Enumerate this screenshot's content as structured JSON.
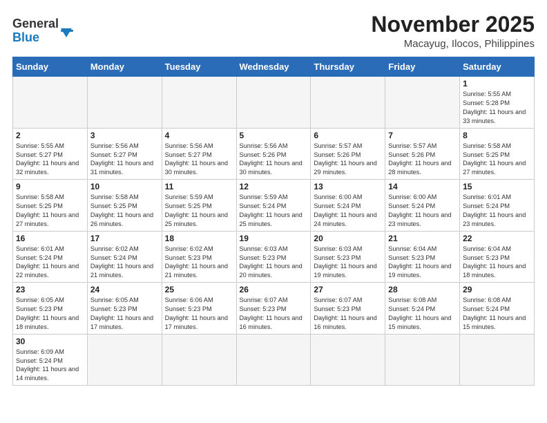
{
  "header": {
    "logo_general": "General",
    "logo_blue": "Blue",
    "month_title": "November 2025",
    "location": "Macayug, Ilocos, Philippines"
  },
  "weekdays": [
    "Sunday",
    "Monday",
    "Tuesday",
    "Wednesday",
    "Thursday",
    "Friday",
    "Saturday"
  ],
  "weeks": [
    [
      {
        "day": "",
        "empty": true
      },
      {
        "day": "",
        "empty": true
      },
      {
        "day": "",
        "empty": true
      },
      {
        "day": "",
        "empty": true
      },
      {
        "day": "",
        "empty": true
      },
      {
        "day": "",
        "empty": true
      },
      {
        "day": "1",
        "sunrise": "Sunrise: 5:55 AM",
        "sunset": "Sunset: 5:28 PM",
        "daylight": "Daylight: 11 hours and 33 minutes."
      }
    ],
    [
      {
        "day": "2",
        "sunrise": "Sunrise: 5:55 AM",
        "sunset": "Sunset: 5:27 PM",
        "daylight": "Daylight: 11 hours and 32 minutes."
      },
      {
        "day": "3",
        "sunrise": "Sunrise: 5:56 AM",
        "sunset": "Sunset: 5:27 PM",
        "daylight": "Daylight: 11 hours and 31 minutes."
      },
      {
        "day": "4",
        "sunrise": "Sunrise: 5:56 AM",
        "sunset": "Sunset: 5:27 PM",
        "daylight": "Daylight: 11 hours and 30 minutes."
      },
      {
        "day": "5",
        "sunrise": "Sunrise: 5:56 AM",
        "sunset": "Sunset: 5:26 PM",
        "daylight": "Daylight: 11 hours and 30 minutes."
      },
      {
        "day": "6",
        "sunrise": "Sunrise: 5:57 AM",
        "sunset": "Sunset: 5:26 PM",
        "daylight": "Daylight: 11 hours and 29 minutes."
      },
      {
        "day": "7",
        "sunrise": "Sunrise: 5:57 AM",
        "sunset": "Sunset: 5:26 PM",
        "daylight": "Daylight: 11 hours and 28 minutes."
      },
      {
        "day": "8",
        "sunrise": "Sunrise: 5:58 AM",
        "sunset": "Sunset: 5:25 PM",
        "daylight": "Daylight: 11 hours and 27 minutes."
      }
    ],
    [
      {
        "day": "9",
        "sunrise": "Sunrise: 5:58 AM",
        "sunset": "Sunset: 5:25 PM",
        "daylight": "Daylight: 11 hours and 27 minutes."
      },
      {
        "day": "10",
        "sunrise": "Sunrise: 5:58 AM",
        "sunset": "Sunset: 5:25 PM",
        "daylight": "Daylight: 11 hours and 26 minutes."
      },
      {
        "day": "11",
        "sunrise": "Sunrise: 5:59 AM",
        "sunset": "Sunset: 5:25 PM",
        "daylight": "Daylight: 11 hours and 25 minutes."
      },
      {
        "day": "12",
        "sunrise": "Sunrise: 5:59 AM",
        "sunset": "Sunset: 5:24 PM",
        "daylight": "Daylight: 11 hours and 25 minutes."
      },
      {
        "day": "13",
        "sunrise": "Sunrise: 6:00 AM",
        "sunset": "Sunset: 5:24 PM",
        "daylight": "Daylight: 11 hours and 24 minutes."
      },
      {
        "day": "14",
        "sunrise": "Sunrise: 6:00 AM",
        "sunset": "Sunset: 5:24 PM",
        "daylight": "Daylight: 11 hours and 23 minutes."
      },
      {
        "day": "15",
        "sunrise": "Sunrise: 6:01 AM",
        "sunset": "Sunset: 5:24 PM",
        "daylight": "Daylight: 11 hours and 23 minutes."
      }
    ],
    [
      {
        "day": "16",
        "sunrise": "Sunrise: 6:01 AM",
        "sunset": "Sunset: 5:24 PM",
        "daylight": "Daylight: 11 hours and 22 minutes."
      },
      {
        "day": "17",
        "sunrise": "Sunrise: 6:02 AM",
        "sunset": "Sunset: 5:24 PM",
        "daylight": "Daylight: 11 hours and 21 minutes."
      },
      {
        "day": "18",
        "sunrise": "Sunrise: 6:02 AM",
        "sunset": "Sunset: 5:23 PM",
        "daylight": "Daylight: 11 hours and 21 minutes."
      },
      {
        "day": "19",
        "sunrise": "Sunrise: 6:03 AM",
        "sunset": "Sunset: 5:23 PM",
        "daylight": "Daylight: 11 hours and 20 minutes."
      },
      {
        "day": "20",
        "sunrise": "Sunrise: 6:03 AM",
        "sunset": "Sunset: 5:23 PM",
        "daylight": "Daylight: 11 hours and 19 minutes."
      },
      {
        "day": "21",
        "sunrise": "Sunrise: 6:04 AM",
        "sunset": "Sunset: 5:23 PM",
        "daylight": "Daylight: 11 hours and 19 minutes."
      },
      {
        "day": "22",
        "sunrise": "Sunrise: 6:04 AM",
        "sunset": "Sunset: 5:23 PM",
        "daylight": "Daylight: 11 hours and 18 minutes."
      }
    ],
    [
      {
        "day": "23",
        "sunrise": "Sunrise: 6:05 AM",
        "sunset": "Sunset: 5:23 PM",
        "daylight": "Daylight: 11 hours and 18 minutes."
      },
      {
        "day": "24",
        "sunrise": "Sunrise: 6:05 AM",
        "sunset": "Sunset: 5:23 PM",
        "daylight": "Daylight: 11 hours and 17 minutes."
      },
      {
        "day": "25",
        "sunrise": "Sunrise: 6:06 AM",
        "sunset": "Sunset: 5:23 PM",
        "daylight": "Daylight: 11 hours and 17 minutes."
      },
      {
        "day": "26",
        "sunrise": "Sunrise: 6:07 AM",
        "sunset": "Sunset: 5:23 PM",
        "daylight": "Daylight: 11 hours and 16 minutes."
      },
      {
        "day": "27",
        "sunrise": "Sunrise: 6:07 AM",
        "sunset": "Sunset: 5:23 PM",
        "daylight": "Daylight: 11 hours and 16 minutes."
      },
      {
        "day": "28",
        "sunrise": "Sunrise: 6:08 AM",
        "sunset": "Sunset: 5:24 PM",
        "daylight": "Daylight: 11 hours and 15 minutes."
      },
      {
        "day": "29",
        "sunrise": "Sunrise: 6:08 AM",
        "sunset": "Sunset: 5:24 PM",
        "daylight": "Daylight: 11 hours and 15 minutes."
      }
    ],
    [
      {
        "day": "30",
        "sunrise": "Sunrise: 6:09 AM",
        "sunset": "Sunset: 5:24 PM",
        "daylight": "Daylight: 11 hours and 14 minutes."
      },
      {
        "day": "",
        "empty": true
      },
      {
        "day": "",
        "empty": true
      },
      {
        "day": "",
        "empty": true
      },
      {
        "day": "",
        "empty": true
      },
      {
        "day": "",
        "empty": true
      },
      {
        "day": "",
        "empty": true
      }
    ]
  ]
}
